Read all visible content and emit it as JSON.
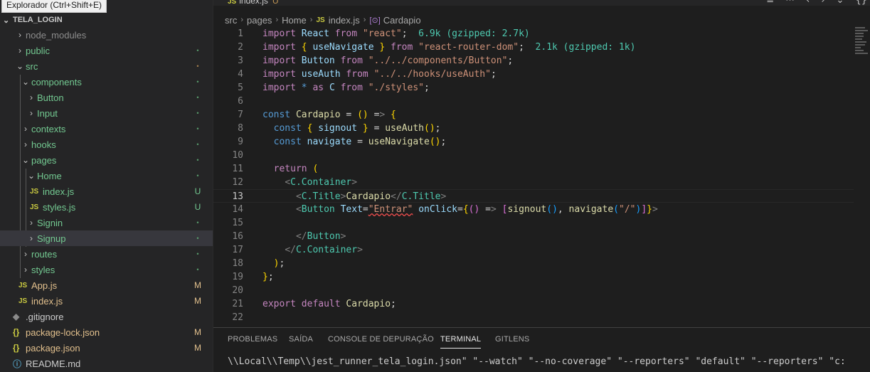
{
  "tooltip": "Explorador (Ctrl+Shift+E)",
  "explorer": {
    "project_name": "TELA_LOGIN",
    "items": [
      {
        "label": "node_modules",
        "badge": ""
      },
      {
        "label": "public",
        "badge": "•"
      },
      {
        "label": "src",
        "badge": "•"
      },
      {
        "label": "components",
        "badge": "•"
      },
      {
        "label": "Button",
        "badge": "•"
      },
      {
        "label": "Input",
        "badge": "•"
      },
      {
        "label": "contexts",
        "badge": "•"
      },
      {
        "label": "hooks",
        "badge": "•"
      },
      {
        "label": "pages",
        "badge": "•"
      },
      {
        "label": "Home",
        "badge": "•"
      },
      {
        "label": "index.js",
        "badge": "U",
        "icon": "JS"
      },
      {
        "label": "styles.js",
        "badge": "U",
        "icon": "JS"
      },
      {
        "label": "Signin",
        "badge": "•"
      },
      {
        "label": "Signup",
        "badge": "•"
      },
      {
        "label": "routes",
        "badge": "•"
      },
      {
        "label": "styles",
        "badge": "•"
      },
      {
        "label": "App.js",
        "badge": "M",
        "icon": "JS"
      },
      {
        "label": "index.js",
        "badge": "M",
        "icon": "JS"
      },
      {
        "label": ".gitignore",
        "badge": ""
      },
      {
        "label": "package-lock.json",
        "badge": "M",
        "icon": "{}"
      },
      {
        "label": "package.json",
        "badge": "M",
        "icon": "{}"
      },
      {
        "label": "README.md",
        "badge": ""
      }
    ]
  },
  "editor": {
    "tab": {
      "icon": "JS",
      "name": "index.js",
      "status": "U"
    },
    "breadcrumb": [
      "src",
      "pages",
      "Home",
      "index.js",
      "Cardapio"
    ],
    "code_lines": [
      "import React from \"react\";  6.9k (gzipped: 2.7k)",
      "import { useNavigate } from \"react-router-dom\";  2.1k (gzipped: 1k)",
      "import Button from \"../../components/Button\";",
      "import useAuth from \"../../hooks/useAuth\";",
      "import * as C from \"./styles\";",
      "",
      "const Cardapio = () => {",
      "  const { signout } = useAuth();",
      "  const navigate = useNavigate();",
      "",
      "  return (",
      "    <C.Container>",
      "      <C.Title>Cardapio</C.Title>",
      "      <Button Text=\"Entrar\" onClick={() => [signout(), navigate(\"/\")]}>",
      "",
      "      </Button>",
      "    </C.Container>",
      "  );",
      "};",
      "",
      "export default Cardapio;",
      ""
    ],
    "current_line": 13
  },
  "panel": {
    "tabs": [
      "PROBLEMAS",
      "SAÍDA",
      "CONSOLE DE DEPURAÇÃO",
      "TERMINAL",
      "GITLENS"
    ],
    "active_tab": "TERMINAL",
    "terminal_text": "\\\\Local\\\\Temp\\\\jest_runner_tela_login.json\" \"--watch\" \"--no-coverage\" \"--reporters\" \"default\" \"--reporters\" \"c:"
  }
}
